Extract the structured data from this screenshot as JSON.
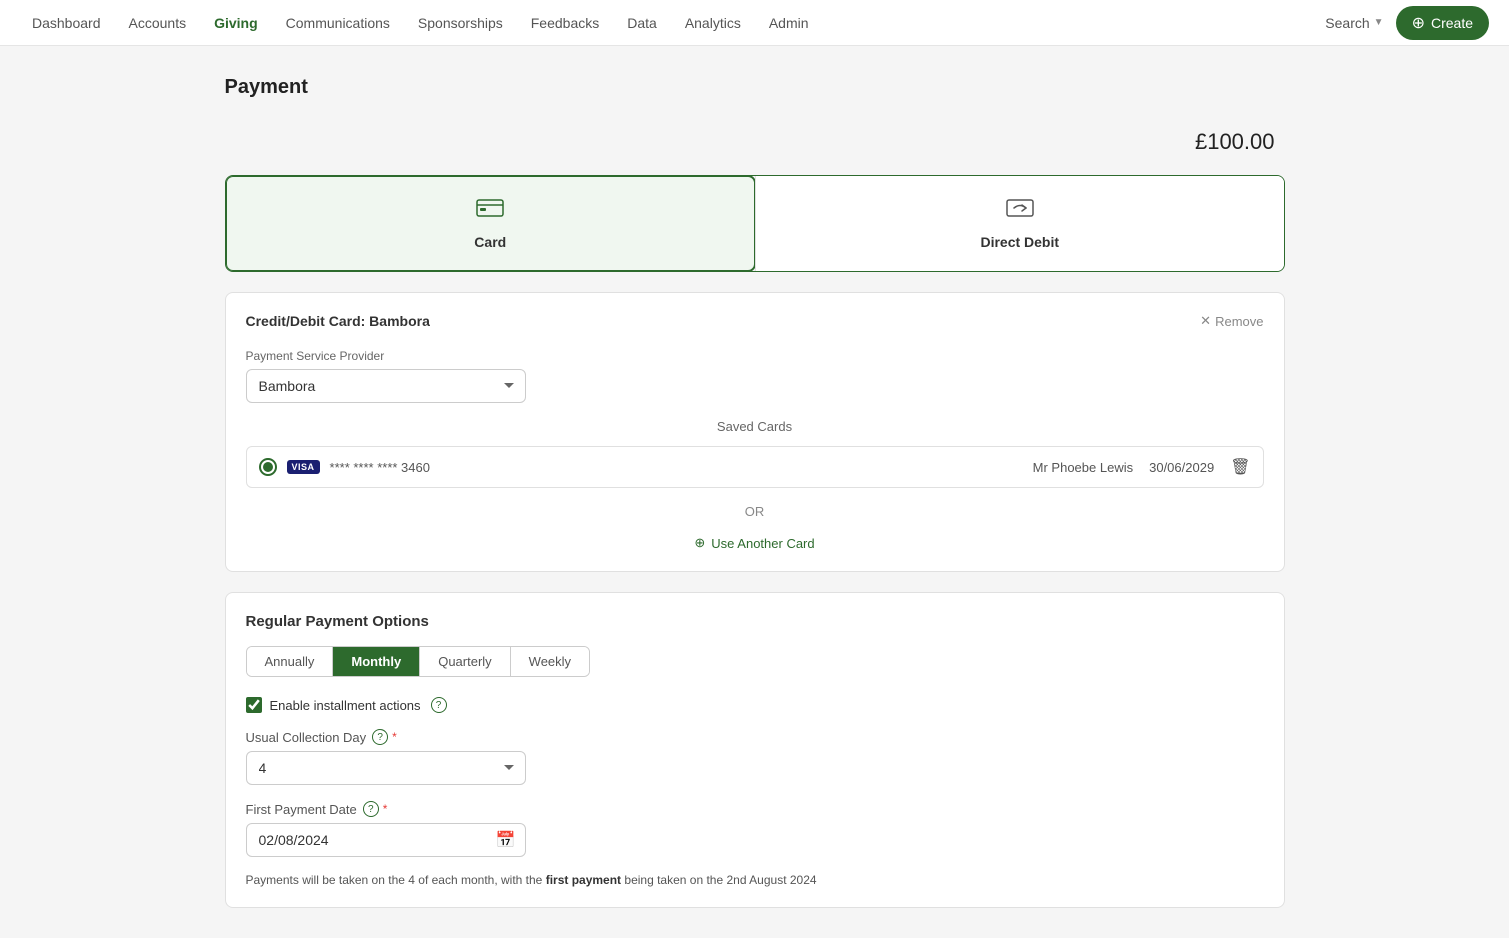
{
  "nav": {
    "items": [
      {
        "label": "Dashboard",
        "active": false
      },
      {
        "label": "Accounts",
        "active": false
      },
      {
        "label": "Giving",
        "active": true
      },
      {
        "label": "Communications",
        "active": false
      },
      {
        "label": "Sponsorships",
        "active": false
      },
      {
        "label": "Feedbacks",
        "active": false
      },
      {
        "label": "Data",
        "active": false
      },
      {
        "label": "Analytics",
        "active": false
      },
      {
        "label": "Admin",
        "active": false
      }
    ],
    "search_label": "Search",
    "create_label": "Create"
  },
  "page": {
    "title": "Payment",
    "amount": "£100.00"
  },
  "payment_tabs": [
    {
      "label": "Card",
      "active": true,
      "icon": "🖥"
    },
    {
      "label": "Direct Debit",
      "active": false,
      "icon": "🔄"
    }
  ],
  "card_section": {
    "title": "Credit/Debit Card: Bambora",
    "remove_label": "Remove",
    "provider_label": "Payment Service Provider",
    "provider_value": "Bambora",
    "saved_cards_label": "Saved Cards",
    "card_number": "**** **** **** 3460",
    "card_holder": "Mr Phoebe Lewis",
    "card_expiry": "30/06/2029",
    "or_label": "OR",
    "use_another_label": "Use Another Card"
  },
  "regular_section": {
    "title": "Regular Payment Options",
    "frequencies": [
      {
        "label": "Annually",
        "active": false
      },
      {
        "label": "Monthly",
        "active": true
      },
      {
        "label": "Quarterly",
        "active": false
      },
      {
        "label": "Weekly",
        "active": false
      }
    ],
    "enable_installment_label": "Enable installment actions",
    "collection_day_label": "Usual Collection Day",
    "collection_day_value": "4",
    "first_payment_date_label": "First Payment Date",
    "first_payment_date_value": "02/08/2024",
    "info_text_prefix": "Payments will be taken on the ",
    "info_text_day": "4",
    "info_text_middle": " of each month, with the ",
    "info_text_bold": "first payment",
    "info_text_suffix": " being taken on the 2nd August 2024"
  }
}
